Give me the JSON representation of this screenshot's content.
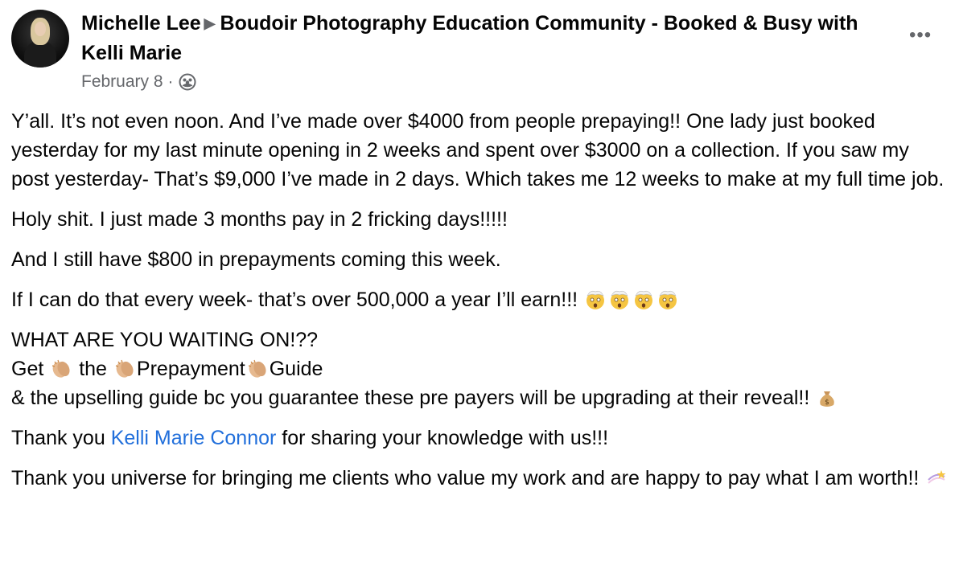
{
  "post": {
    "author": "Michelle Lee",
    "group": "Boudoir Photography Education Community - Booked & Busy with Kelli Marie",
    "date": "February 8",
    "meta_separator": "·",
    "more_icon": "more-horizontal-icon",
    "paragraphs": {
      "p1": "Y’all. It’s not even noon. And I’ve made over $4000 from people prepaying!! One lady just booked yesterday for my last minute opening in 2 weeks and spent over $3000 on a collection. If you saw my post yesterday- That’s $9,000 I’ve made in 2 days. Which takes me 12 weeks to make at my full time job.",
      "p2": "Holy shit. I just made 3 months pay in 2 fricking days!!!!!",
      "p3": "And I still have $800 in prepayments coming this week.",
      "p4": "If I can do that every week- that’s over 500,000 a year I’ll earn!!!",
      "p5_line1": "WHAT ARE YOU WAITING ON!??",
      "p5_line2_a": "Get",
      "p5_line2_b": "the",
      "p5_line2_c": "Prepayment",
      "p5_line2_d": "Guide",
      "p5_line3": "& the upselling guide bc you guarantee these pre payers will be upgrading at their reveal!!",
      "p6_before": "Thank you",
      "p6_link": "Kelli Marie Connor",
      "p6_after": "for sharing your knowledge with us!!!",
      "p7": "Thank you universe for bringing me clients who value my work and are happy to pay what I am worth!!"
    }
  }
}
